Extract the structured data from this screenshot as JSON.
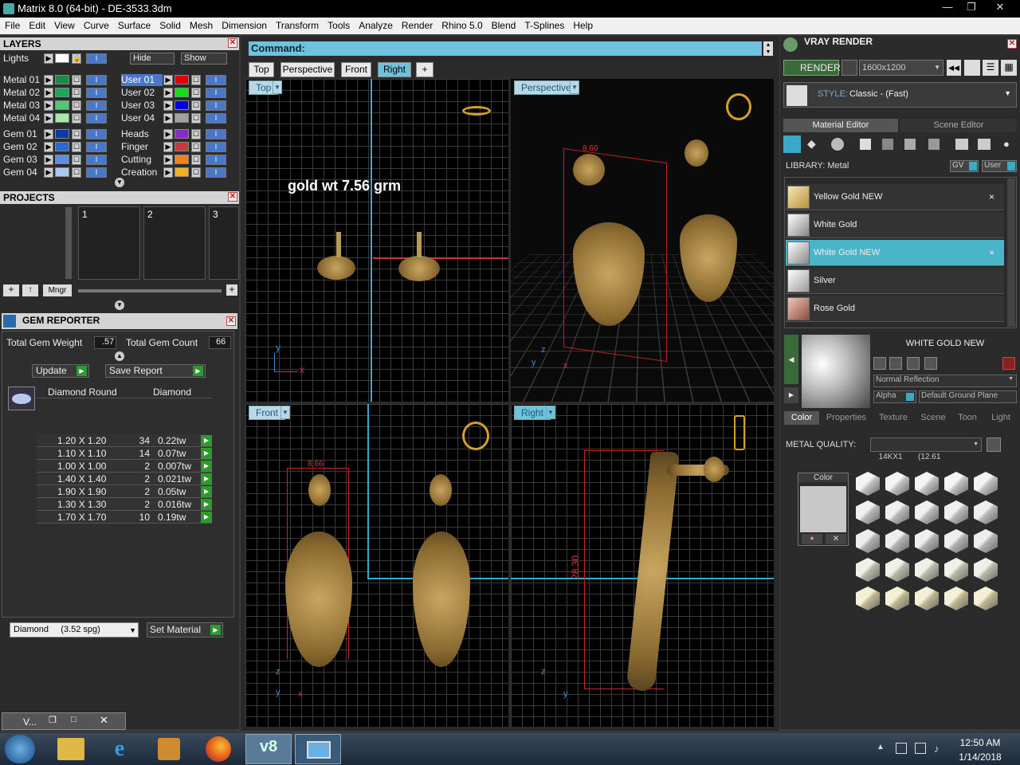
{
  "window": {
    "title": "Matrix 8.0 (64-bit) - DE-3533.3dm"
  },
  "menu": [
    "File",
    "Edit",
    "View",
    "Curve",
    "Surface",
    "Solid",
    "Mesh",
    "Dimension",
    "Transform",
    "Tools",
    "Analyze",
    "Render",
    "Rhino 5.0",
    "Blend",
    "T-Splines",
    "Help"
  ],
  "layers": {
    "title": "LAYERS",
    "lights_label": "Lights",
    "hide_label": "Hide",
    "show_label": "Show",
    "left_items": [
      {
        "name": "Metal 01",
        "color": "#1d8a4a"
      },
      {
        "name": "Metal 02",
        "color": "#18a858"
      },
      {
        "name": "Metal 03",
        "color": "#50c870"
      },
      {
        "name": "Metal 04",
        "color": "#a8e8a8"
      },
      {
        "name": "Gem 01",
        "color": "#0a3aa8"
      },
      {
        "name": "Gem 02",
        "color": "#2a68d8"
      },
      {
        "name": "Gem 03",
        "color": "#5a90e0"
      },
      {
        "name": "Gem 04",
        "color": "#a8c8f0"
      }
    ],
    "right_items": [
      {
        "name": "User 01",
        "color": "#e00000"
      },
      {
        "name": "User 02",
        "color": "#10e010"
      },
      {
        "name": "User 03",
        "color": "#0000e0"
      },
      {
        "name": "User 04",
        "color": "#a0a0a0"
      },
      {
        "name": "Heads",
        "color": "#8a2ac8"
      },
      {
        "name": "Finger",
        "color": "#c83a3a"
      },
      {
        "name": "Cutting",
        "color": "#f08020"
      },
      {
        "name": "Creation",
        "color": "#f0b020"
      }
    ]
  },
  "projects": {
    "title": "PROJECTS",
    "slots": [
      "1",
      "2",
      "3"
    ],
    "mngr_label": "Mngr"
  },
  "gem_reporter": {
    "title": "GEM REPORTER",
    "weight_label": "Total Gem Weight",
    "weight_value": ".57",
    "count_label": "Total Gem Count",
    "count_value": "66",
    "update_label": "Update",
    "save_label": "Save Report",
    "col1": "Diamond Round",
    "col2": "Diamond",
    "rows": [
      {
        "size": "1.20 X 1.20",
        "count": "34",
        "wt": "0.22tw"
      },
      {
        "size": "1.10 X 1.10",
        "count": "14",
        "wt": "0.07tw"
      },
      {
        "size": "1.00 X 1.00",
        "count": "2",
        "wt": "0.007tw"
      },
      {
        "size": "1.40 X 1.40",
        "count": "2",
        "wt": "0.021tw"
      },
      {
        "size": "1.90 X 1.90",
        "count": "2",
        "wt": "0.05tw"
      },
      {
        "size": "1.30 X 1.30",
        "count": "2",
        "wt": "0.016tw"
      },
      {
        "size": "1.70 X 1.70",
        "count": "10",
        "wt": "0.19tw"
      }
    ],
    "material_select": "Diamond     (3.52 spg)",
    "set_material_label": "Set Material"
  },
  "command": {
    "label": "Command:"
  },
  "view_tabs": [
    "Top",
    "Perspective",
    "Front",
    "Right",
    "+"
  ],
  "viewports": {
    "top": {
      "label": "Top",
      "annotation": "gold wt 7.56 grm"
    },
    "perspective": {
      "label": "Perspective",
      "dim": "8.66"
    },
    "front": {
      "label": "Front",
      "dim": "8.66"
    },
    "right": {
      "label": "Right",
      "dim": "28.30"
    }
  },
  "axes": {
    "x": "x",
    "y": "y",
    "z": "z"
  },
  "vray": {
    "title": "VRAY RENDER",
    "render_label": "RENDER",
    "resolution": "1600x1200",
    "style_label": "STYLE:",
    "style_value": "Classic - (Fast)",
    "tabs": [
      "Material Editor",
      "Scene Editor"
    ],
    "library_label": "LIBRARY: Metal",
    "gv_label": "GV",
    "user_label": "User",
    "materials": [
      {
        "name": "Yellow Gold NEW",
        "removable": "×"
      },
      {
        "name": "White Gold",
        "removable": ""
      },
      {
        "name": "White Gold NEW",
        "removable": "×"
      },
      {
        "name": "Silver",
        "removable": ""
      },
      {
        "name": "Rose Gold",
        "removable": ""
      }
    ],
    "preview_title": "WHITE GOLD NEW",
    "reflection_select": "Normal Reflection",
    "alpha_label": "Alpha",
    "ground_select": "Default Ground Plane",
    "prop_tabs": [
      "Color",
      "Properties",
      "Texture",
      "Scene",
      "Toon",
      "Light"
    ],
    "metal_quality_label": "METAL QUALITY:",
    "metal_quality_value": "14KX1       (12.61",
    "color_label": "Color"
  },
  "mini_window": {
    "label": "V..."
  },
  "taskbar": {
    "time": "12:50 AM",
    "date": "1/14/2018",
    "v8_label": "v8"
  },
  "icons": [
    "windows-start-icon",
    "file-explorer-icon",
    "internet-explorer-icon",
    "media-player-icon",
    "firefox-icon",
    "matrix-icon",
    "photo-viewer-icon"
  ]
}
